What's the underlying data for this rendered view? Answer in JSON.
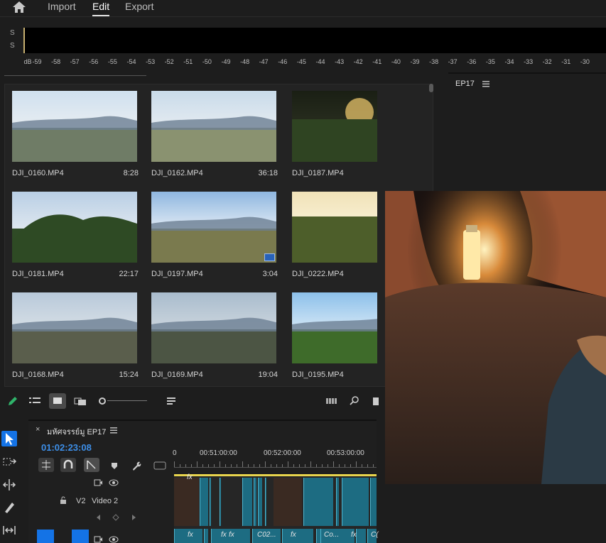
{
  "nav": {
    "tabs": [
      "Import",
      "Edit",
      "Export"
    ],
    "active": "Edit"
  },
  "meter": {
    "channels": [
      "S",
      "S"
    ],
    "unit": "dB",
    "ticks": [
      "-59",
      "-58",
      "-57",
      "-56",
      "-55",
      "-54",
      "-53",
      "-52",
      "-51",
      "-50",
      "-49",
      "-48",
      "-47",
      "-46",
      "-45",
      "-44",
      "-43",
      "-42",
      "-41",
      "-40",
      "-39",
      "-38",
      "-37",
      "-36",
      "-35",
      "-34",
      "-33",
      "-32",
      "-31",
      "-30"
    ]
  },
  "bin": {
    "clips": [
      {
        "name": "DJI_0160.MP4",
        "duration": "8:28",
        "scene": "valley"
      },
      {
        "name": "DJI_0162.MP4",
        "duration": "36:18",
        "scene": "fields"
      },
      {
        "name": "DJI_0187.MP4",
        "duration": "",
        "scene": "forest-night"
      },
      {
        "name": "DJI_0181.MP4",
        "duration": "22:17",
        "scene": "trees"
      },
      {
        "name": "DJI_0197.MP4",
        "duration": "3:04",
        "scene": "farm",
        "badge": true
      },
      {
        "name": "DJI_0222.MP4",
        "duration": "",
        "scene": "sunset"
      },
      {
        "name": "DJI_0168.MP4",
        "duration": "15:24",
        "scene": "valley2"
      },
      {
        "name": "DJI_0169.MP4",
        "duration": "19:04",
        "scene": "hills"
      },
      {
        "name": "DJI_0195.MP4",
        "duration": "",
        "scene": "green"
      }
    ]
  },
  "program": {
    "sequence_name": "EP17"
  },
  "timeline": {
    "sequence_tab": "มหัศจรรย์มู EP17",
    "timecode": "01:02:23:08",
    "ruler": [
      "00:51:00:00",
      "00:52:00:00",
      "00:53:00:00"
    ],
    "ruler_partial": "0",
    "track_v2_id": "V2",
    "track_v2_name": "Video 2",
    "clip_labels": [
      "fx",
      "fx",
      "fx",
      "C02...",
      "fx",
      "Co...",
      "fx",
      "C("
    ]
  },
  "colors": {
    "accent": "#3d8fe8",
    "clip": "#1d6c82",
    "tool_active": "#1473e6"
  }
}
